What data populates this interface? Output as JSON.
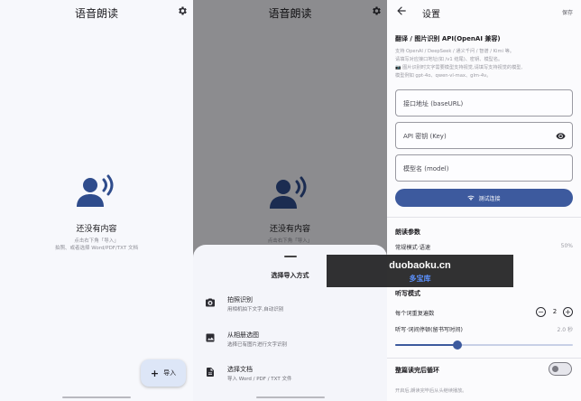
{
  "colors": {
    "accent": "#3d5a9e",
    "fab_bg": "#dde6f7",
    "scrim": "rgba(0,0,0,0.42)"
  },
  "home": {
    "title": "语音朗读",
    "empty_title": "还没有内容",
    "empty_hint_line1": "点击右下角「导入」",
    "empty_hint_line2": "拍照、或者选择 Word/PDF/TXT 文档",
    "fab_label": "导入",
    "icons": {
      "settings": "gear-icon",
      "empty": "speaking-person-icon",
      "fab": "plus-icon"
    }
  },
  "import_sheet": {
    "title": "语音朗读",
    "empty_title": "还没有内容",
    "empty_hint_line1": "点击右下角「导入」",
    "sheet_title": "选择导入方式",
    "options": [
      {
        "title": "拍照识别",
        "subtitle": "用相机拍下文字,自动识别",
        "icon": "camera-icon"
      },
      {
        "title": "从相册选图",
        "subtitle": "选择已有图片进行文字识别",
        "icon": "image-icon"
      },
      {
        "title": "选择文档",
        "subtitle": "导入 Word / PDF / TXT 文件",
        "icon": "document-icon"
      }
    ]
  },
  "settings": {
    "title": "设置",
    "save_label": "保存",
    "api_section_title": "翻译 / 图片识别 API(OpenAI 兼容)",
    "api_desc_line1": "支持 OpenAI / DeepSeek / 通义千问 / 智谱 / Kimi 等。",
    "api_desc_line2": "请填写对应接口地址(如 /v1 结尾)、密钥、模型名。",
    "api_desc_line3": "📷 图片识别时文字需要模型支持视觉,请填写支持视觉的模型,",
    "api_desc_line4": "模型例如 gpt-4o、qwen-vl-max、glm-4v。",
    "fields": {
      "base_url_label": "接口地址 (baseURL)",
      "api_key_label": "API 密钥 (Key)",
      "model_label": "模型名 (model)"
    },
    "test_button_label": "测试连接",
    "read_section_title": "朗读参数",
    "normal_speed_label": "常规模式·语速",
    "normal_speed_value": "50%",
    "dictation_section_title": "听写模式",
    "repeat_count_label": "每个词重复遍数",
    "repeat_count_value": "2",
    "interval_label": "听写·词间停顿(留书写时间)",
    "interval_value": "2.0 秒",
    "interval_fraction": 0.35,
    "loop_label": "整篇读完后循环",
    "loop_enabled": false,
    "loop_hint": "开启后,朗读完毕后从头继续播放。"
  },
  "watermark": {
    "line1": "duobaoku.cn",
    "line2": "多宝库"
  }
}
